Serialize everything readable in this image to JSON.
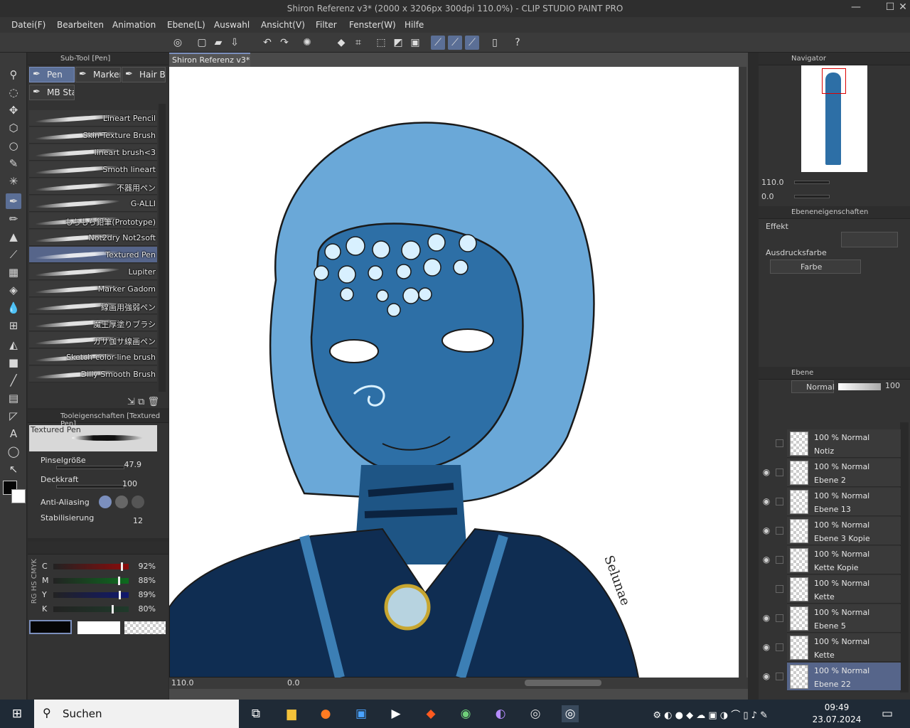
{
  "window": {
    "title": "Shiron Referenz v3* (2000 x 3206px 300dpi 110.0%)  - CLIP STUDIO PAINT PRO",
    "minimize": "—",
    "maximize": "☐",
    "close": "✕"
  },
  "menu": [
    "Datei(F)",
    "Bearbeiten",
    "Animation",
    "Ebene(L)",
    "Auswahl",
    "Ansicht(V)",
    "Filter",
    "Fenster(W)",
    "Hilfe"
  ],
  "subtool": {
    "header": "Sub-Tool [Pen]",
    "tabs": [
      "Pen",
      "Marker",
      "Hair Br",
      "MB Sta"
    ],
    "brushes": [
      "Lineart Pencil",
      "Skin Texture Brush",
      "lineart brush<3",
      "Smoth lineart",
      "不器用ペン",
      "G-ALLI",
      "もちもち鉛筆(Prototype)",
      "Not2dry Not2soft",
      "Textured Pen",
      "Lupiter",
      "Marker Gadom",
      "線画用強弱ペン",
      "魔王厚塗りブラシ",
      "ガサ伽サ線画ペン",
      "Sketch-color-line brush",
      "Dilly Smooth Brush"
    ],
    "active_brush": "Textured Pen"
  },
  "toolprops": {
    "header": "Tooleigenschaften [Textured Pen]",
    "preview_label": "Textured Pen",
    "brush_size_label": "Pinselgröße",
    "brush_size_value": "47.9",
    "opacity_label": "Deckkraft",
    "opacity_value": "100",
    "aa_label": "Anti-Aliasing",
    "stab_label": "Stabilisierung",
    "stab_value": "12"
  },
  "color": {
    "side_labels": "RG HS CMYK",
    "channels": [
      {
        "label": "C",
        "value": "92%",
        "color": "#8b0b0b",
        "fraction": 0.92
      },
      {
        "label": "M",
        "value": "88%",
        "color": "#0d6b1e",
        "fraction": 0.88
      },
      {
        "label": "Y",
        "value": "89%",
        "color": "#10186d",
        "fraction": 0.89
      },
      {
        "label": "K",
        "value": "80%",
        "color": "#1f3a2a",
        "fraction": 0.8
      }
    ],
    "main_color": "#050505",
    "sub_color": "#ffffff"
  },
  "canvas": {
    "tab": "Shiron Referenz v3*",
    "zoom": "110.0",
    "rotation": "0.0",
    "signature": "Selunae"
  },
  "navigator": {
    "header": "Navigator",
    "zoom": "110.0",
    "rotation": "0.0"
  },
  "layer_props": {
    "header": "Ebeneneigenschaften",
    "effect_label": "Effekt",
    "expr_label": "Ausdrucksfarbe",
    "expr_value": "Farbe"
  },
  "layers_panel": {
    "header": "Ebene",
    "blend_mode": "Normal",
    "opacity": "100",
    "layers": [
      {
        "blend": "100 % Normal",
        "name": "Notiz",
        "visible": false
      },
      {
        "blend": "100 % Normal",
        "name": "Ebene 2",
        "visible": true
      },
      {
        "blend": "100 % Normal",
        "name": "Ebene 13",
        "visible": true
      },
      {
        "blend": "100 % Normal",
        "name": "Ebene 3 Kopie",
        "visible": true
      },
      {
        "blend": "100 % Normal",
        "name": "Kette Kopie",
        "visible": true
      },
      {
        "blend": "100 % Normal",
        "name": "Kette",
        "visible": false
      },
      {
        "blend": "100 % Normal",
        "name": "Ebene 5",
        "visible": true
      },
      {
        "blend": "100 % Normal",
        "name": "Kette",
        "visible": true
      },
      {
        "blend": "100 % Normal",
        "name": "Ebene 22",
        "visible": true,
        "active": true
      }
    ]
  },
  "taskbar": {
    "search": "Suchen",
    "time": "09:49",
    "date": "23.07.2024"
  }
}
